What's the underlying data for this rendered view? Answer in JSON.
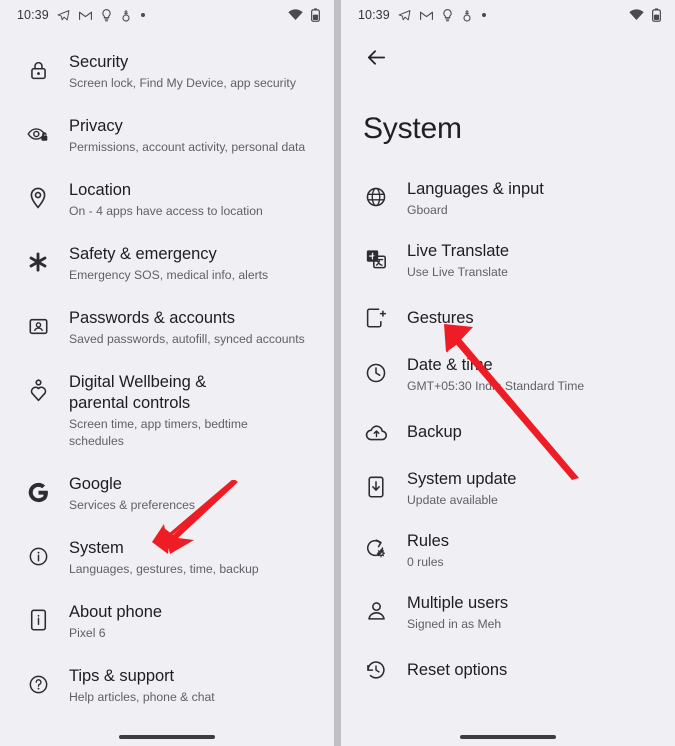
{
  "statusbar": {
    "time": "10:39",
    "left_icons": [
      "telegram-icon",
      "gmail-icon",
      "bulb-icon",
      "thermometer-icon",
      "dot-icon"
    ],
    "right_icons": [
      "wifi-icon",
      "battery-icon"
    ]
  },
  "left_screen": {
    "name": "settings-list-screen",
    "items": [
      {
        "icon": "lock-icon",
        "title": "Security",
        "subtitle": "Screen lock, Find My Device, app security"
      },
      {
        "icon": "eye-lock-icon",
        "title": "Privacy",
        "subtitle": "Permissions, account activity, personal data"
      },
      {
        "icon": "location-pin-icon",
        "title": "Location",
        "subtitle": "On - 4 apps have access to location"
      },
      {
        "icon": "asterisk-icon",
        "title": "Safety & emergency",
        "subtitle": "Emergency SOS, medical info, alerts"
      },
      {
        "icon": "account-card-icon",
        "title": "Passwords & accounts",
        "subtitle": "Saved passwords, autofill, synced accounts"
      },
      {
        "icon": "wellbeing-icon",
        "title": "Digital Wellbeing & parental controls",
        "subtitle": "Screen time, app timers, bedtime schedules"
      },
      {
        "icon": "google-g-icon",
        "title": "Google",
        "subtitle": "Services & preferences"
      },
      {
        "icon": "info-circle-icon",
        "title": "System",
        "subtitle": "Languages, gestures, time, backup"
      },
      {
        "icon": "phone-info-icon",
        "title": "About phone",
        "subtitle": "Pixel 6"
      },
      {
        "icon": "help-circle-icon",
        "title": "Tips & support",
        "subtitle": "Help articles, phone & chat"
      }
    ]
  },
  "right_screen": {
    "name": "system-screen",
    "back_label": "back-arrow",
    "title": "System",
    "items": [
      {
        "icon": "globe-icon",
        "title": "Languages & input",
        "subtitle": "Gboard"
      },
      {
        "icon": "translate-icon",
        "title": "Live Translate",
        "subtitle": "Use Live Translate"
      },
      {
        "icon": "gesture-phone-icon",
        "title": "Gestures",
        "subtitle": ""
      },
      {
        "icon": "clock-icon",
        "title": "Date & time",
        "subtitle": "GMT+05:30 India Standard Time"
      },
      {
        "icon": "cloud-upload-icon",
        "title": "Backup",
        "subtitle": ""
      },
      {
        "icon": "system-update-icon",
        "title": "System update",
        "subtitle": "Update available"
      },
      {
        "icon": "rules-icon",
        "title": "Rules",
        "subtitle": "0 rules"
      },
      {
        "icon": "person-icon",
        "title": "Multiple users",
        "subtitle": "Signed in as Meh"
      },
      {
        "icon": "history-icon",
        "title": "Reset options",
        "subtitle": ""
      }
    ]
  },
  "annotations": {
    "arrow_color": "#ee1c25",
    "left_arrow_points_to": "System",
    "right_arrow_points_to": "Gestures"
  },
  "colors": {
    "background": "#f0eff4",
    "title_text": "#1d1e21",
    "subtitle_text": "#5e6167",
    "accent_red": "#ee1c25"
  }
}
